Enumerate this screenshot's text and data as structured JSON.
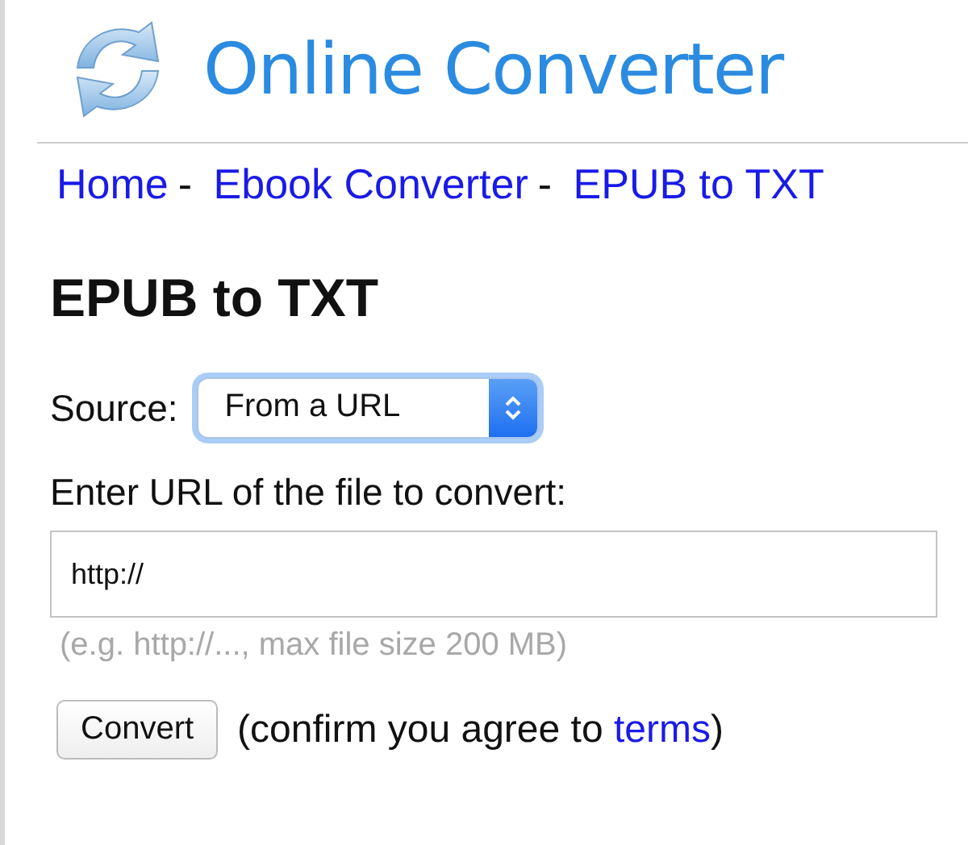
{
  "site": {
    "title": "Online Converter"
  },
  "breadcrumb": {
    "separator": "-",
    "items": [
      {
        "label": "Home"
      },
      {
        "label": "Ebook Converter"
      },
      {
        "label": "EPUB to TXT"
      }
    ]
  },
  "heading": "EPUB to TXT",
  "source": {
    "label": "Source:",
    "value": "From a URL"
  },
  "url_field": {
    "label": "Enter URL of the file to convert:",
    "value": "http://",
    "hint": "(e.g. http://..., max file size 200 MB)"
  },
  "convert_button": "Convert",
  "terms_note": {
    "before": "(confirm you agree to ",
    "link": "terms",
    "after": ")"
  }
}
